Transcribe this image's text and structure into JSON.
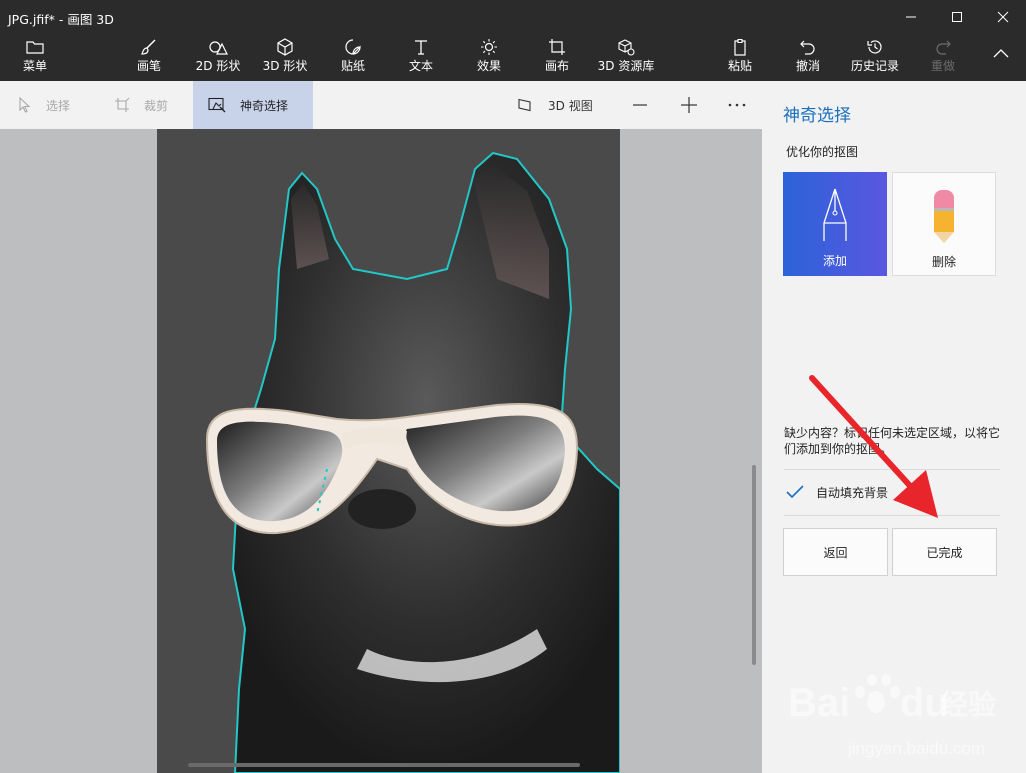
{
  "titlebar": {
    "title": "JPG.jfif* - 画图 3D"
  },
  "ribbon": {
    "menu": "菜单",
    "brushes": "画笔",
    "shapes_2d": "2D 形状",
    "shapes_3d": "3D 形状",
    "stickers": "贴纸",
    "text": "文本",
    "effects": "效果",
    "canvas": "画布",
    "library_3d": "3D 资源库",
    "paste": "粘贴",
    "undo": "撤消",
    "history": "历史记录",
    "redo": "重做"
  },
  "subbar": {
    "select": "选择",
    "crop": "裁剪",
    "magic_select": "神奇选择",
    "view_3d": "3D 视图"
  },
  "panel": {
    "title": "神奇选择",
    "subtitle": "优化你的抠图",
    "add_label": "添加",
    "remove_label": "删除",
    "hint": "缺少内容？标记任何未选定区域，以将它们添加到你的抠图。",
    "autofill_label": "自动填充背景",
    "autofill_checked": true,
    "back_label": "返回",
    "done_label": "已完成"
  },
  "watermark": {
    "brand": "Bai",
    "brand2": "du",
    "product": "经验",
    "url": "jingyan.baidu.com"
  },
  "colors": {
    "accent": "#1a6fbf",
    "arrow": "#e8252b",
    "outline": "#22c7c7"
  }
}
